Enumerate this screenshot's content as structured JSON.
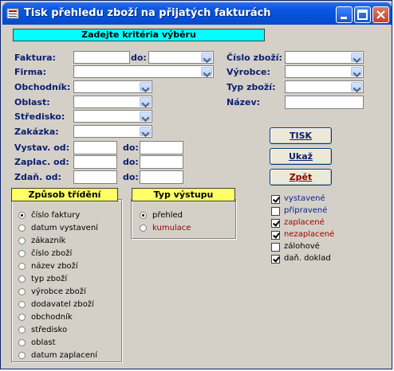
{
  "window": {
    "title": "Tisk přehledu zboží na přijatých fakturách"
  },
  "criteria": {
    "header": "Zadejte kritéria výběru",
    "faktura_label": "Faktura:",
    "do_label": "do:",
    "firma_label": "Firma:",
    "obchodnik_label": "Obchodník:",
    "oblast_label": "Oblast:",
    "stredisko_label": "Středisko:",
    "zakazka_label": "Zakázka:",
    "vystav_label": "Vystav. od:",
    "zaplac_label": "Zaplac. od:",
    "zdan_label": "Zdaň. od:",
    "cislo_zbozi_label": "Číslo zboží:",
    "vyrobce_label": "Výrobce:",
    "typ_zbozi_label": "Typ zboží:",
    "nazev_label": "Název:"
  },
  "buttons": {
    "tisk": "TISK",
    "ukaz": "Ukaž",
    "zpet": "Zpět"
  },
  "sort": {
    "header": "Způsob třídění",
    "options": [
      "číslo faktury",
      "datum vystavení",
      "zákazník",
      "číslo zboží",
      "název zboží",
      "typ zboží",
      "výrobce zboží",
      "dodavatel zboží",
      "obchodník",
      "středisko",
      "oblast",
      "datum zaplacení"
    ],
    "selected": "číslo faktury"
  },
  "output": {
    "header": "Typ výstupu",
    "options": [
      "přehled",
      "kumulace"
    ],
    "selected": "přehled"
  },
  "filters": [
    {
      "label": "vystavené",
      "checked": true,
      "color": "#0a1e8c"
    },
    {
      "label": "připravené",
      "checked": false,
      "color": "#0a1e8c"
    },
    {
      "label": "zaplacené",
      "checked": true,
      "color": "#a00000"
    },
    {
      "label": "nezaplacené",
      "checked": true,
      "color": "#a00000"
    },
    {
      "label": "zálohové",
      "checked": false,
      "color": "#000000"
    },
    {
      "label": "daň. doklad",
      "checked": true,
      "color": "#000000"
    }
  ],
  "colors": {
    "criteria_header": "#00ffff",
    "group_header": "#ffff66",
    "zpet_text": "#8b0000"
  }
}
